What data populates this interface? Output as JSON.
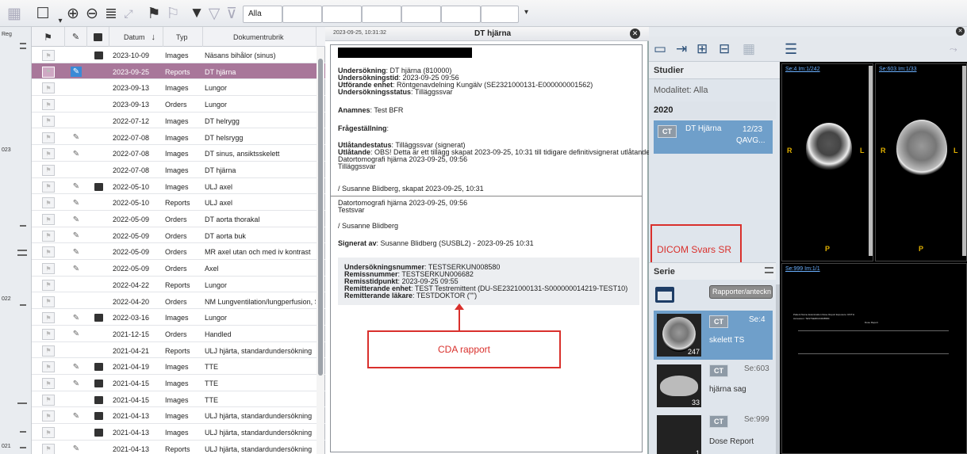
{
  "toolbar": {
    "icons": [
      "grid-icon",
      "frame-select-icon",
      "zoom-in-icon",
      "zoom-out-icon",
      "list-icon",
      "expand-icon",
      "flag-icon",
      "flag-clear-icon",
      "filter-icon",
      "filter-image-icon",
      "filter-clear-icon"
    ],
    "filter_value": "Alla"
  },
  "timeline": {
    "labels": [
      "Reg",
      "023",
      "022",
      "021"
    ]
  },
  "doclist": {
    "headers": {
      "date": "Datum",
      "sort": "↓",
      "type": "Typ",
      "title": "Dokumentrubrik"
    },
    "rows": [
      {
        "date": "2023-10-09",
        "type": "Images",
        "title": "Näsans bihålor (sinus)",
        "clip": false,
        "img": true,
        "sel": false
      },
      {
        "date": "2023-09-25",
        "type": "Reports",
        "title": "DT hjärna",
        "clip": true,
        "img": false,
        "sel": true
      },
      {
        "date": "2023-09-13",
        "type": "Images",
        "title": "Lungor",
        "clip": false,
        "img": false,
        "sel": false
      },
      {
        "date": "2023-09-13",
        "type": "Orders",
        "title": "Lungor",
        "clip": false,
        "img": false,
        "sel": false
      },
      {
        "date": "2022-07-12",
        "type": "Images",
        "title": "DT helrygg",
        "clip": false,
        "img": false,
        "sel": false
      },
      {
        "date": "2022-07-08",
        "type": "Images",
        "title": "DT helsrygg",
        "clip": true,
        "img": false,
        "sel": false
      },
      {
        "date": "2022-07-08",
        "type": "Images",
        "title": "DT sinus, ansiktsskelett",
        "clip": true,
        "img": false,
        "sel": false
      },
      {
        "date": "2022-07-08",
        "type": "Images",
        "title": "DT hjärna",
        "clip": false,
        "img": false,
        "sel": false
      },
      {
        "date": "2022-05-10",
        "type": "Images",
        "title": "ULJ axel",
        "clip": true,
        "img": true,
        "sel": false
      },
      {
        "date": "2022-05-10",
        "type": "Reports",
        "title": "ULJ axel",
        "clip": true,
        "img": false,
        "sel": false
      },
      {
        "date": "2022-05-09",
        "type": "Orders",
        "title": "DT aorta thorakal",
        "clip": true,
        "img": false,
        "sel": false
      },
      {
        "date": "2022-05-09",
        "type": "Orders",
        "title": "DT aorta buk",
        "clip": true,
        "img": false,
        "sel": false
      },
      {
        "date": "2022-05-09",
        "type": "Orders",
        "title": "MR axel utan och med iv kontrast",
        "clip": true,
        "img": false,
        "sel": false
      },
      {
        "date": "2022-05-09",
        "type": "Orders",
        "title": "Axel",
        "clip": true,
        "img": false,
        "sel": false
      },
      {
        "date": "2022-04-22",
        "type": "Reports",
        "title": "Lungor",
        "clip": false,
        "img": false,
        "sel": false
      },
      {
        "date": "2022-04-20",
        "type": "Orders",
        "title": "NM Lungventilation/lungperfusion, SPEC",
        "clip": false,
        "img": false,
        "sel": false
      },
      {
        "date": "2022-03-16",
        "type": "Images",
        "title": "Lungor",
        "clip": true,
        "img": true,
        "sel": false
      },
      {
        "date": "2021-12-15",
        "type": "Orders",
        "title": "Handled",
        "clip": true,
        "img": false,
        "sel": false
      },
      {
        "date": "2021-04-21",
        "type": "Reports",
        "title": "ULJ hjärta, standardundersökning",
        "clip": false,
        "img": false,
        "sel": false
      },
      {
        "date": "2021-04-19",
        "type": "Images",
        "title": "TTE",
        "clip": true,
        "img": true,
        "sel": false
      },
      {
        "date": "2021-04-15",
        "type": "Images",
        "title": "TTE",
        "clip": true,
        "img": true,
        "sel": false
      },
      {
        "date": "2021-04-15",
        "type": "Images",
        "title": "TTE",
        "clip": false,
        "img": true,
        "sel": false
      },
      {
        "date": "2021-04-13",
        "type": "Images",
        "title": "ULJ hjärta, standardundersökning",
        "clip": true,
        "img": true,
        "sel": false
      },
      {
        "date": "2021-04-13",
        "type": "Images",
        "title": "ULJ hjärta, standardundersökning",
        "clip": false,
        "img": true,
        "sel": false
      },
      {
        "date": "2021-04-13",
        "type": "Reports",
        "title": "ULJ hjärta, standardundersökning",
        "clip": true,
        "img": false,
        "sel": false
      }
    ]
  },
  "report": {
    "timestamp": "2023-09-25, 10:31:32",
    "title": "DT hjärna",
    "close": "✕",
    "lines": [
      {
        "k": "Undersökning",
        "v": ": DT hjärna (810000)"
      },
      {
        "k": "Undersökningstid",
        "v": ": 2023-09-25 09:56"
      },
      {
        "k": "Utförande enhet",
        "v": ": Röntgenavdelning Kungälv (SE2321000131-E000000001562)"
      },
      {
        "k": "Undersökningsstatus",
        "v": ": Tilläggssvar"
      }
    ],
    "anamnes_k": "Anamnes",
    "anamnes_v": ": Test BFR",
    "fragestallning": "Frågeställning",
    "fragestallning_colon": ":",
    "utl_status_k": "Utlåtandestatus",
    "utl_status_v": ": Tilläggssvar (signerat)",
    "utl_k": "Utlåtande",
    "utl_v": ": OBS! Detta är ett tillägg skapat 2023-09-25, 10:31 till tidigare definitivsignerat utlåtande",
    "utl_2": "Datortomografi hjärna 2023-09-25, 09:56",
    "utl_3": "Tilläggssvar",
    "creator": "/ Susanne Blidberg, skapat 2023-09-25, 10:31",
    "prev_1": "Datortomografi hjärna 2023-09-25, 09:56",
    "prev_2": "Testsvar",
    "prev_sign": "/ Susanne Blidberg",
    "signed_k": "Signerat av",
    "signed_v": ": Susanne Blidberg (SUSBL2) - 2023-09-25 10:31",
    "refs": [
      {
        "k": "Undersökningsnummer",
        "v": ": TESTSERKUN008580"
      },
      {
        "k": "Remissnummer",
        "v": ": TESTSERKUN006682"
      },
      {
        "k": "Remisstidpunkt",
        "v": ": 2023-09-25 09:55"
      },
      {
        "k": "Remitterande enhet",
        "v": ": TEST Testremittent (DU-SE2321000131-S000000014219-TEST10)"
      },
      {
        "k": "Remitterande läkare",
        "v": ": TESTDOKTOR (\"\")"
      }
    ],
    "cda_label": "CDA rapport"
  },
  "studies": {
    "section": "Studier",
    "modality": "Modalitet: Alla",
    "year": "2020",
    "study": {
      "badge": "CT",
      "name": "DT Hjärna",
      "count": "12/23",
      "sub": "QAVG..."
    },
    "dicom_label": "DICOM Svars SR",
    "serie": "Serie",
    "report_btn": "Rapporter/anteckn",
    "series": [
      {
        "badge": "CT",
        "se": "Se:4",
        "name": "skelett TS",
        "num": "247"
      },
      {
        "badge": "CT",
        "se": "Se:603",
        "name": "hjärna sag",
        "num": "33"
      },
      {
        "badge": "CT",
        "se": "Se:999",
        "name": "Dose Report",
        "num": "1"
      }
    ]
  },
  "viewer": {
    "close": "✕",
    "vp1": "Se:4  Im:1/242",
    "vp2": "Se:603  Im:1/33",
    "vp3": "Se:999  Im:1/1",
    "r": "R",
    "l": "L",
    "p": "P",
    "tool_menu": "☰",
    "dose_lines": [
      "Patient Name  Examination Dose Report  Exposure: ROTH",
      "Accession: TESTSERKUN008580",
      "Dose Report"
    ]
  }
}
